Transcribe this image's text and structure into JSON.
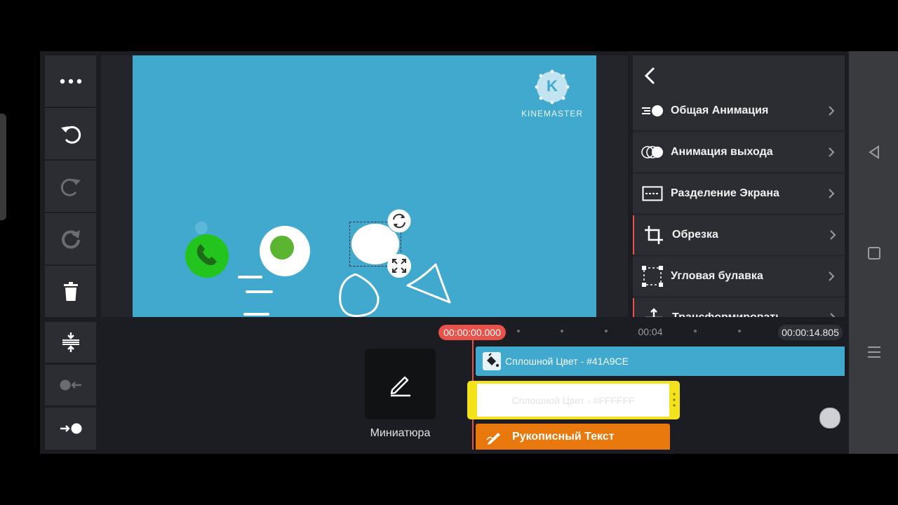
{
  "toolbar": {
    "more": "more-icon",
    "undo": "undo-icon",
    "redo": "redo-icon",
    "restore": "restore-icon",
    "delete": "trash-icon",
    "bottom": [
      "level-icon",
      "pin-in-icon",
      "pin-out-icon"
    ]
  },
  "preview": {
    "background": "#41A9CE",
    "watermark": "KINEMASTER",
    "watermark_letter": "K"
  },
  "panel": {
    "back": "back-arrow-icon",
    "items": [
      {
        "label": "Общая Анимация",
        "icon": "motion-icon"
      },
      {
        "label": "Анимация выхода",
        "icon": "out-animation-icon"
      },
      {
        "label": "Разделение Экрана",
        "icon": "split-screen-icon"
      },
      {
        "label": "Обрезка",
        "icon": "crop-icon"
      },
      {
        "label": "Угловая булавка",
        "icon": "corner-pin-icon"
      },
      {
        "label": "Трансформировать",
        "icon": "transform-icon"
      }
    ]
  },
  "timeline": {
    "playhead_time": "00:00:00.000",
    "mark_time": "00:04",
    "total_time": "00:00:14.805",
    "thumbnail_label": "Миниатюра",
    "tracks": [
      {
        "label": "Сплошной Цвет - #41A9CE",
        "color": "#41A9CE",
        "icon": "paint-bucket-icon"
      },
      {
        "label": "Сплошной Цвет - #FFFFFF",
        "color": "#FFFFFF",
        "border": "#F4E21B"
      },
      {
        "label": "Рукописный Текст",
        "color": "#E9780D",
        "icon": "handwriting-icon"
      }
    ]
  },
  "colors": {
    "accent_red": "#E8524A",
    "panel_bg": "#2b2d33",
    "playhead": "#E8524A"
  }
}
